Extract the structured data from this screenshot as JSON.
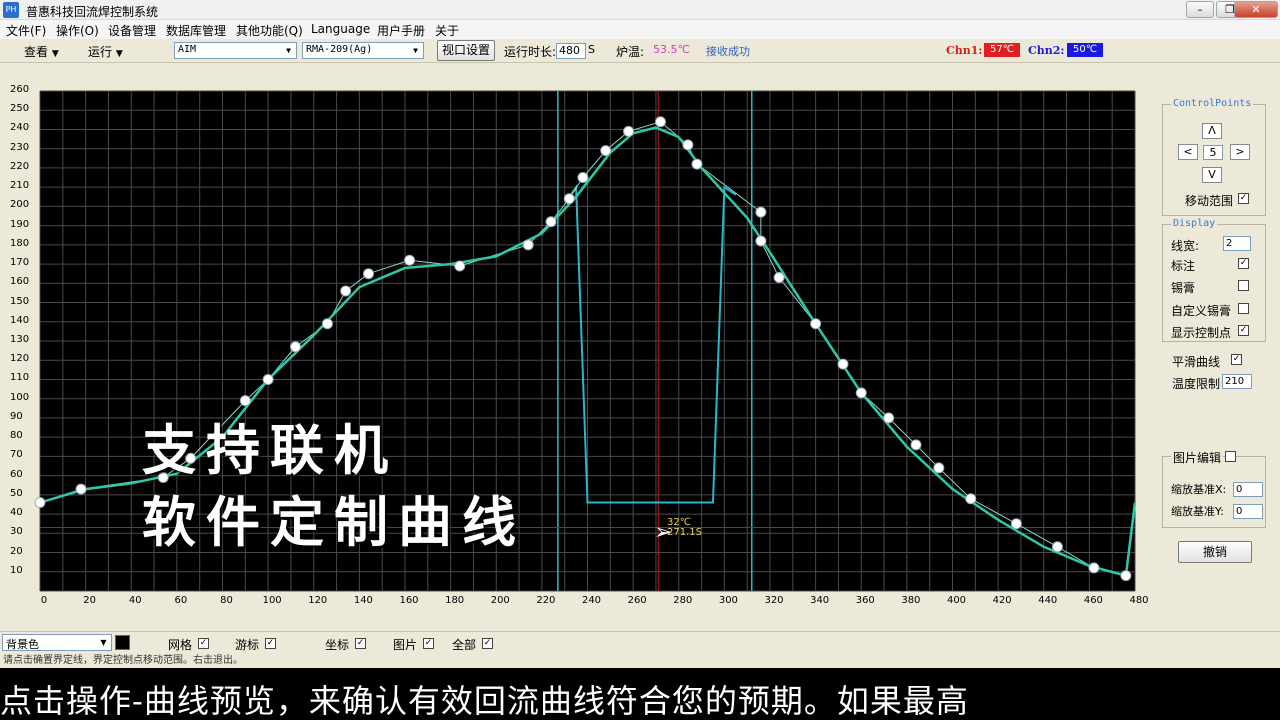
{
  "window": {
    "title": "普惠科技回流焊控制系统",
    "icon_text": "PH"
  },
  "menu": [
    "文件(F)",
    "操作(O)",
    "设备管理",
    "数据库管理",
    "其他功能(Q)",
    "Language",
    "用户手册",
    "关于"
  ],
  "toolbar": {
    "view_label": "查看",
    "run_label": "运行",
    "brand_select": "AIM",
    "paste_select": "RMA-209(Ag)",
    "viewport_button": "视口设置",
    "runtime_label": "运行时长:",
    "runtime_value": "480",
    "runtime_unit": "S",
    "furnace_temp_label": "炉温:",
    "furnace_temp_value": "53.5℃",
    "receive_status": "接收成功",
    "chn1_label": "Chn1:",
    "chn1_value": "57℃",
    "chn2_label": "Chn2:",
    "chn2_value": "50℃"
  },
  "colors": {
    "plot_bg": "#000000",
    "grid": "#4a4a4a",
    "curve": "#2ec8a8",
    "window": "#2ab8c8",
    "points": "#ffffff",
    "cursor": "#c01818",
    "chn1_bg": "#e02020",
    "chn2_bg": "#1a1ae0",
    "furnace_temp": "#d040c0",
    "receive_status": "#3060c0"
  },
  "cursor": {
    "temp": "32℃",
    "time": "271.1S"
  },
  "chart_data": {
    "type": "line",
    "xlim": [
      0,
      480
    ],
    "ylim": [
      0,
      260
    ],
    "x_ticks": [
      0,
      20,
      40,
      60,
      80,
      100,
      120,
      140,
      160,
      180,
      200,
      220,
      240,
      260,
      280,
      300,
      320,
      340,
      360,
      380,
      400,
      420,
      440,
      460,
      480
    ],
    "y_ticks": [
      10,
      20,
      30,
      40,
      50,
      60,
      70,
      80,
      90,
      100,
      110,
      120,
      130,
      140,
      150,
      160,
      170,
      180,
      190,
      200,
      210,
      220,
      230,
      240,
      250,
      260
    ],
    "grid": true,
    "series": [
      {
        "kind": "control_points",
        "x": [
          0,
          18,
          54,
          66,
          90,
          100,
          112,
          126,
          134,
          144,
          162,
          184,
          214,
          224,
          232,
          238,
          248,
          258,
          272,
          284,
          288,
          316,
          316,
          324,
          340,
          352,
          360,
          372,
          384,
          394,
          408,
          428,
          446,
          462,
          476
        ],
        "y": [
          46,
          53,
          59,
          69,
          99,
          110,
          127,
          139,
          156,
          165,
          172,
          169,
          180,
          192,
          204,
          215,
          229,
          239,
          244,
          232,
          222,
          197,
          182,
          163,
          139,
          118,
          103,
          90,
          76,
          64,
          48,
          35,
          23,
          12,
          8
        ]
      },
      {
        "kind": "smooth_curve",
        "x": [
          0,
          20,
          40,
          60,
          80,
          100,
          120,
          140,
          160,
          180,
          200,
          220,
          235,
          250,
          260,
          270,
          280,
          290,
          300,
          310,
          320,
          340,
          360,
          380,
          400,
          420,
          440,
          460,
          476,
          480
        ],
        "y": [
          46,
          53,
          56,
          61,
          80,
          110,
          133,
          158,
          168,
          170,
          174,
          186,
          205,
          228,
          238,
          241,
          236,
          220,
          207,
          194,
          176,
          139,
          103,
          75,
          53,
          37,
          23,
          13,
          8,
          46
        ]
      },
      {
        "kind": "window_profile",
        "x": [
          231,
          235,
          240,
          295,
          300,
          305
        ],
        "y": [
          203,
          210,
          46,
          46,
          210,
          206
        ]
      }
    ],
    "vertical_markers_x": [
      227,
      312
    ],
    "cursor_x": 271,
    "cursor_y": 33
  },
  "right_panel": {
    "control_points_title": "ControlPoints",
    "cp_up": "Λ",
    "cp_left": "<",
    "cp_value": "5",
    "cp_right": ">",
    "cp_down": "V",
    "move_range_label": "移动范围",
    "move_range_checked": "✓",
    "display_title": "Display",
    "line_width_label": "线宽:",
    "line_width_value": "2",
    "annotate_label": "标注",
    "annotate_checked": "✓",
    "solder_paste_label": "锡膏",
    "custom_paste_label": "自定义锡膏",
    "show_points_label": "显示控制点",
    "show_points_checked": "✓",
    "smooth_label": "平滑曲线",
    "smooth_checked": "✓",
    "temp_limit_label": "温度限制",
    "temp_limit_value": "210",
    "image_edit_label": "图片编辑",
    "scale_x_label": "缩放基准X:",
    "scale_x_value": "0",
    "scale_y_label": "缩放基准Y:",
    "scale_y_value": "0",
    "undo_button": "撤销"
  },
  "bottom_bar": {
    "bg_color_select": "背景色",
    "grid_label": "网格",
    "grid_checked": "✓",
    "cursor_label": "游标",
    "cursor_checked": "✓",
    "axis_label": "坐标",
    "axis_checked": "✓",
    "image_label": "图片",
    "image_checked": "✓",
    "all_label": "全部",
    "all_checked": "✓"
  },
  "status_bar": "请点击确置界定线，界定控制点移动范围。右击退出。",
  "overlay": {
    "line1": "支持联机",
    "line2": "软件定制曲线"
  },
  "subtitle": "点击操作-曲线预览，来确认有效回流曲线符合您的预期。如果最高"
}
